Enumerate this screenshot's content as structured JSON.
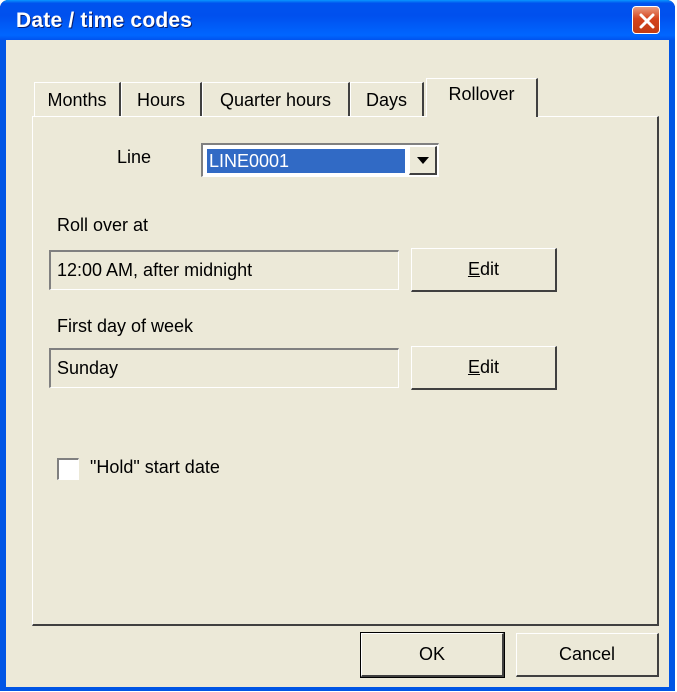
{
  "window": {
    "title": "Date / time codes"
  },
  "tabs": [
    {
      "label": "Months"
    },
    {
      "label": "Hours"
    },
    {
      "label": "Quarter hours"
    },
    {
      "label": "Days"
    },
    {
      "label": "Rollover",
      "active": true
    }
  ],
  "line": {
    "label": "Line",
    "value": "LINE0001"
  },
  "rollover": {
    "label": "Roll over at",
    "value": "12:00 AM, after midnight",
    "button": "Edit"
  },
  "first_day": {
    "label": "First day of week",
    "value": "Sunday",
    "button": "Edit"
  },
  "hold": {
    "label": "\"Hold\" start date",
    "checked": false
  },
  "footer": {
    "ok": "OK",
    "cancel": "Cancel"
  },
  "colors": {
    "selection": "#316ac5",
    "dialog_bg": "#ece9d8",
    "titlebar": "#0053ee",
    "close": "#d5441e"
  }
}
